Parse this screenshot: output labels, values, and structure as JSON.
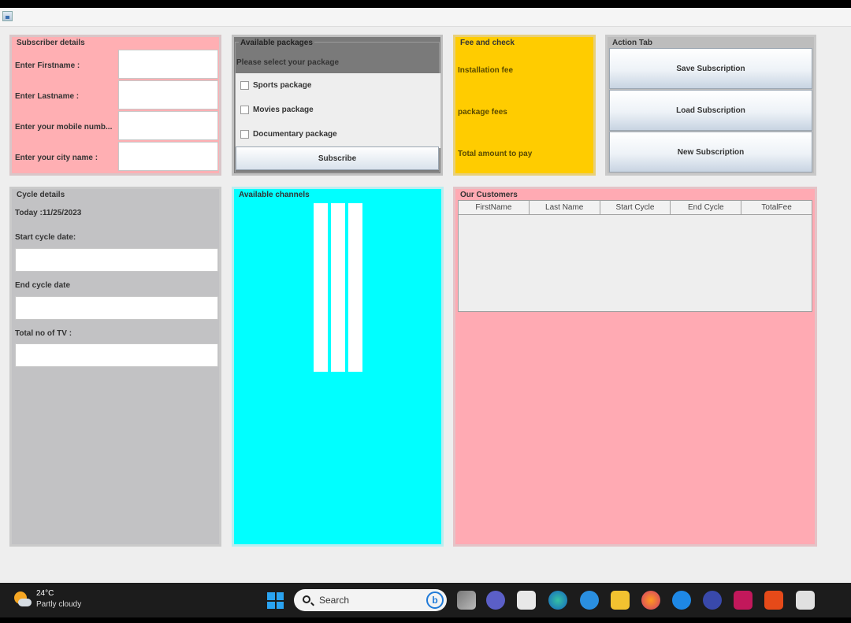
{
  "subscriber": {
    "title": "Subscriber details",
    "firstname_label": "Enter Firstname :",
    "lastname_label": "Enter Lastname :",
    "mobile_label": "Enter your mobile numb...",
    "city_label": "Enter your city name :"
  },
  "packages": {
    "title": "Available packages",
    "prompt": "Please select your package",
    "items": [
      "Sports package",
      "Movies package",
      "Documentary package"
    ],
    "subscribe_label": "Subscribe"
  },
  "fee": {
    "title": "Fee and check",
    "installation_label": "Installation fee",
    "package_label": "package fees",
    "total_label": "Total amount to pay"
  },
  "action": {
    "title": "Action Tab",
    "save_label": "Save Subscription",
    "load_label": "Load Subscription",
    "new_label": "New Subscription"
  },
  "cycle": {
    "title": "Cycle details",
    "today": "Today :11/25/2023",
    "start_label": "Start cycle date:",
    "end_label": "End cycle date",
    "tv_label": "Total no of TV :"
  },
  "channels": {
    "title": "Available channels"
  },
  "customers": {
    "title": "Our Customers",
    "columns": [
      "FirstName",
      "Last Name",
      "Start Cycle",
      "End Cycle",
      "TotalFee"
    ]
  },
  "taskbar": {
    "temperature": "24°C",
    "condition": "Partly cloudy",
    "search_label": "Search",
    "bing_glyph": "b"
  },
  "colors": {
    "subscriber_bg": "#ffafb3",
    "packages_bg": "#7a7a7a",
    "fee_bg": "#ffcc00",
    "action_bg": "#bdbdbd",
    "cycle_bg": "#c2c2c4",
    "channels_bg": "#00ffff",
    "customers_bg": "#ffaab3"
  }
}
